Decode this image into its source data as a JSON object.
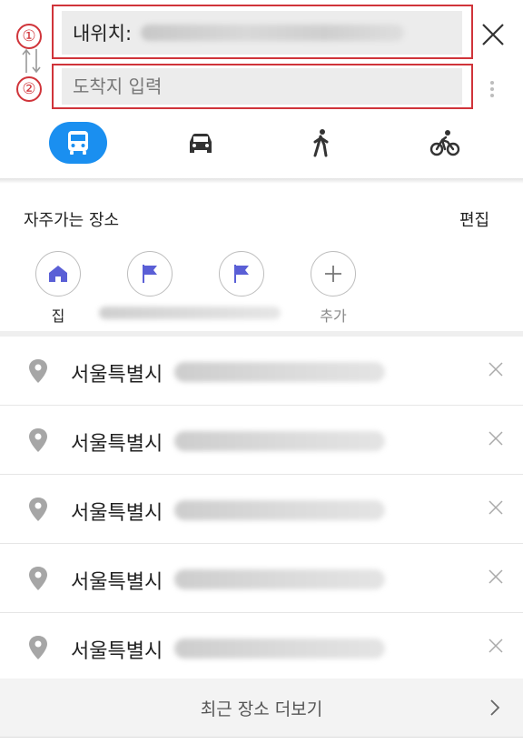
{
  "header": {
    "annotation_1": "①",
    "annotation_2": "②",
    "origin_label": "내위치:",
    "destination_placeholder": "도착지 입력",
    "transport_modes": [
      {
        "name": "transit",
        "icon": "bus-icon",
        "active": true
      },
      {
        "name": "car",
        "icon": "car-icon",
        "active": false
      },
      {
        "name": "walk",
        "icon": "walking-icon",
        "active": false
      },
      {
        "name": "bike",
        "icon": "bicycle-icon",
        "active": false
      }
    ]
  },
  "frequent_places": {
    "title": "자주가는 장소",
    "edit_label": "편집",
    "items": [
      {
        "label": "집",
        "icon": "home-icon"
      },
      {
        "label": "",
        "icon": "flag-icon"
      },
      {
        "label": "",
        "icon": "flag-icon"
      },
      {
        "label": "추가",
        "icon": "plus-icon"
      }
    ]
  },
  "recent": {
    "items": [
      {
        "city": "서울특별시"
      },
      {
        "city": "서울특별시"
      },
      {
        "city": "서울특별시"
      },
      {
        "city": "서울특별시"
      },
      {
        "city": "서울특별시"
      }
    ],
    "more_label": "최근 장소 더보기"
  },
  "colors": {
    "accent": "#1a8ff0",
    "annotation_red": "#d0343a",
    "place_icon": "#5a5fd6"
  }
}
